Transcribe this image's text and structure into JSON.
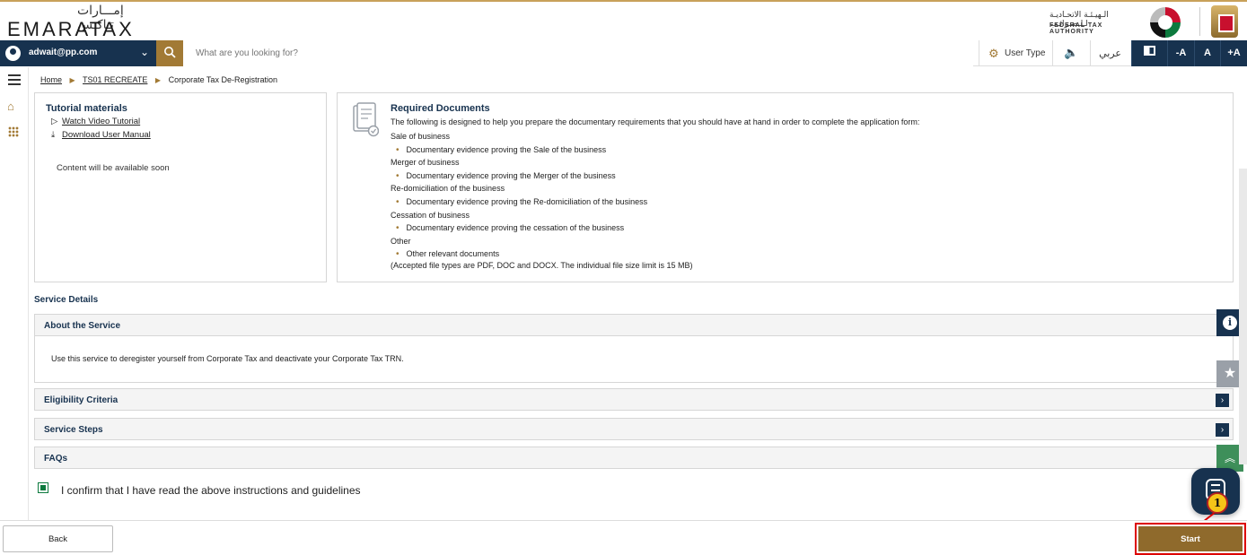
{
  "brand": {
    "logo_ar": "إمـــارات تـاكـس",
    "logo_en": "EMARATAX",
    "authority_ar": "الـهيـئـة الاتحـاديـة لـلـضـرائـب",
    "authority_en": "FEDERAL TAX AUTHORITY"
  },
  "nav": {
    "user_email": "adwait@pp.com",
    "search_placeholder": "What are you looking for?",
    "user_type_label": "User Type",
    "language_label": "عربي",
    "font_decrease": "-A",
    "font_reset": "A",
    "font_increase": "+A"
  },
  "breadcrumb": {
    "home": "Home",
    "parent": "TS01 RECREATE",
    "current": "Corporate Tax De-Registration"
  },
  "tutorial": {
    "title": "Tutorial materials",
    "video_link": "Watch Video Tutorial",
    "manual_link": "Download User Manual",
    "content_note": "Content will be available soon"
  },
  "required_documents": {
    "title": "Required Documents",
    "intro": "The following is designed to help you prepare the documentary requirements that you should have at hand in order to complete the application form:",
    "groups": [
      {
        "category": "Sale of business",
        "item": "Documentary evidence proving the Sale of the business"
      },
      {
        "category": "Merger of business",
        "item": "Documentary evidence proving the Merger of the business"
      },
      {
        "category": "Re-domiciliation of the business",
        "item": "Documentary evidence proving the Re-domiciliation of the business"
      },
      {
        "category": "Cessation of business",
        "item": "Documentary evidence proving the cessation of the business"
      },
      {
        "category": "Other",
        "item": "Other relevant documents"
      }
    ],
    "note": "(Accepted file types are PDF, DOC and DOCX. The individual file size limit is 15 MB)"
  },
  "service_details": {
    "title": "Service Details",
    "about_label": "About the Service",
    "about_text": "Use this service to deregister yourself from Corporate Tax and deactivate your Corporate Tax TRN.",
    "eligibility_label": "Eligibility Criteria",
    "steps_label": "Service Steps",
    "faqs_label": "FAQs"
  },
  "confirm": {
    "label": "I confirm that I have read the above instructions and guidelines",
    "checked": true
  },
  "annotation": {
    "step_number": "1"
  },
  "footer": {
    "back_label": "Back",
    "start_label": "Start"
  },
  "colors": {
    "navy": "#17324f",
    "gold": "#a27a35",
    "start_button": "#8f6a2c",
    "highlight_red": "#d00000"
  },
  "icons": {
    "search": "search-icon",
    "user": "user-icon",
    "menu": "menu-icon",
    "home": "home-icon",
    "apps": "apps-grid-icon",
    "info": "info-icon",
    "star": "star-icon",
    "chat": "chat-icon"
  }
}
